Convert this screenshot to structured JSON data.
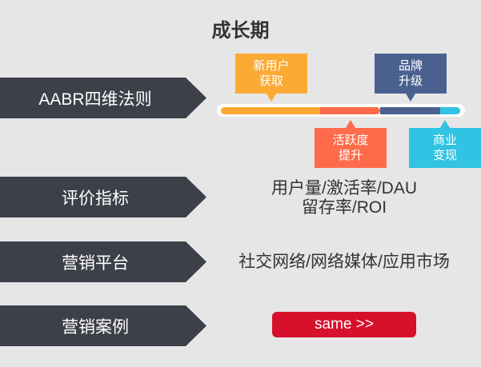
{
  "title": "成长期",
  "rows": [
    {
      "label": "AABR四维法则"
    },
    {
      "label": "评价指标",
      "value_line1": "用户量/激活率/DAU",
      "value_line2": "留存率/ROI"
    },
    {
      "label": "营销平台",
      "value": "社交网络/网络媒体/应用市场"
    },
    {
      "label": "营销案例",
      "button": "same >>"
    }
  ],
  "stages": [
    {
      "line1": "新用户",
      "line2": "获取",
      "color": "#fbaa33"
    },
    {
      "line1": "活跃度",
      "line2": "提升",
      "color": "#ff6b4a"
    },
    {
      "line1": "品牌",
      "line2": "升级",
      "color": "#4a6190"
    },
    {
      "line1": "商业",
      "line2": "变现",
      "color": "#30c3e3"
    }
  ]
}
